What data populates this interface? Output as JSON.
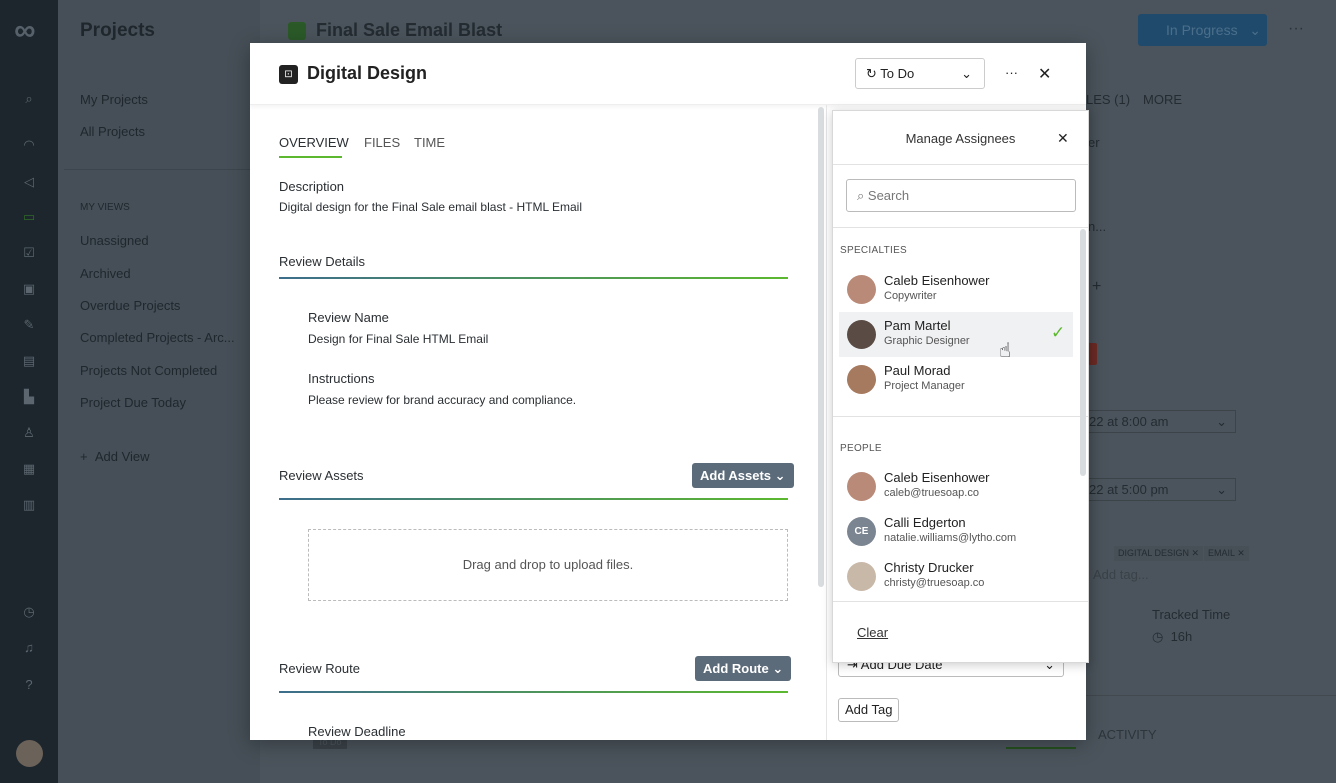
{
  "app": {
    "sidebar_title": "Projects",
    "nav": [
      "My Projects",
      "All Projects"
    ],
    "views_heading": "MY VIEWS",
    "views": [
      "Unassigned",
      "Archived",
      "Overdue Projects",
      "Completed Projects - Arc...",
      "Projects Not Completed",
      "Project Due Today"
    ],
    "add_view": "Add View"
  },
  "project": {
    "title": "Final Sale Email Blast",
    "status": "In Progress",
    "tabs_partial": [
      "LES (1)",
      "MORE"
    ],
    "field_partial": [
      "er",
      "n..."
    ],
    "start_date": "22 at 8:00 am",
    "due_date": "22 at 5:00 pm",
    "tags": [
      "DIGITAL DESIGN",
      "EMAIL"
    ],
    "add_tag_placeholder": "Add tag...",
    "tracked_time_label": "Tracked Time",
    "tracked_time": "16h",
    "activity_tab": "ACTIVITY",
    "badge": "To Do"
  },
  "modal": {
    "title": "Digital Design",
    "status": "To Do",
    "tabs": [
      "OVERVIEW",
      "FILES",
      "TIME"
    ],
    "description_label": "Description",
    "description": "Digital design for the Final Sale email blast - HTML Email",
    "review_details": "Review Details",
    "review_name_label": "Review Name",
    "review_name": "Design for Final Sale HTML Email",
    "instructions_label": "Instructions",
    "instructions": "Please review for brand accuracy and compliance.",
    "review_assets": "Review Assets",
    "add_assets": "Add Assets",
    "dropzone": "Drag and drop to upload files.",
    "review_route": "Review Route",
    "add_route": "Add Route",
    "review_deadline": "Review Deadline",
    "add_due_date": "Add Due Date",
    "add_tag": "Add Tag"
  },
  "assignees": {
    "title": "Manage Assignees",
    "search_placeholder": "Search",
    "specialties_label": "SPECIALTIES",
    "specialties": [
      {
        "name": "Caleb Eisenhower",
        "sub": "Copywriter"
      },
      {
        "name": "Pam Martel",
        "sub": "Graphic Designer",
        "selected": true
      },
      {
        "name": "Paul Morad",
        "sub": "Project Manager"
      }
    ],
    "people_label": "PEOPLE",
    "people": [
      {
        "name": "Caleb Eisenhower",
        "sub": "caleb@truesoap.co"
      },
      {
        "name": "Calli Edgerton",
        "sub": "natalie.williams@lytho.com",
        "initials": "CE"
      },
      {
        "name": "Christy Drucker",
        "sub": "christy@truesoap.co"
      }
    ],
    "clear": "Clear"
  }
}
